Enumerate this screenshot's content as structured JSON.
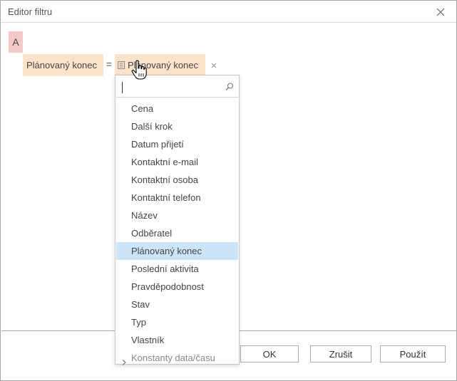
{
  "window": {
    "title": "Editor filtru"
  },
  "filter": {
    "group_operator": "A",
    "condition": {
      "field": "Plánovaný konec",
      "operator": "=",
      "value": "Plánovaný konec"
    }
  },
  "dropdown": {
    "search_value": "",
    "items": [
      "Cena",
      "Další krok",
      "Datum přijetí",
      "Kontaktní e-mail",
      "Kontaktní osoba",
      "Kontaktní telefon",
      "Název",
      "Odběratel",
      "Plánovaný konec",
      "Poslední aktivita",
      "Pravděpodobnost",
      "Stav",
      "Typ",
      "Vlastník"
    ],
    "selected_item": "Plánovaný konec",
    "group_item": "Konstanty data/času"
  },
  "buttons": {
    "ok": "OK",
    "cancel": "Zrušit",
    "apply": "Použít"
  },
  "colors": {
    "group_background": "#f6c9c9",
    "condition_background": "#fde3cc",
    "selection_background": "#cce4f7"
  },
  "icons": {
    "close": "close-icon",
    "remove": "remove-icon",
    "value_type": "field-list-icon",
    "search": "search-icon",
    "expand": "chevron-right-icon",
    "cursor": "hand-cursor-icon"
  }
}
